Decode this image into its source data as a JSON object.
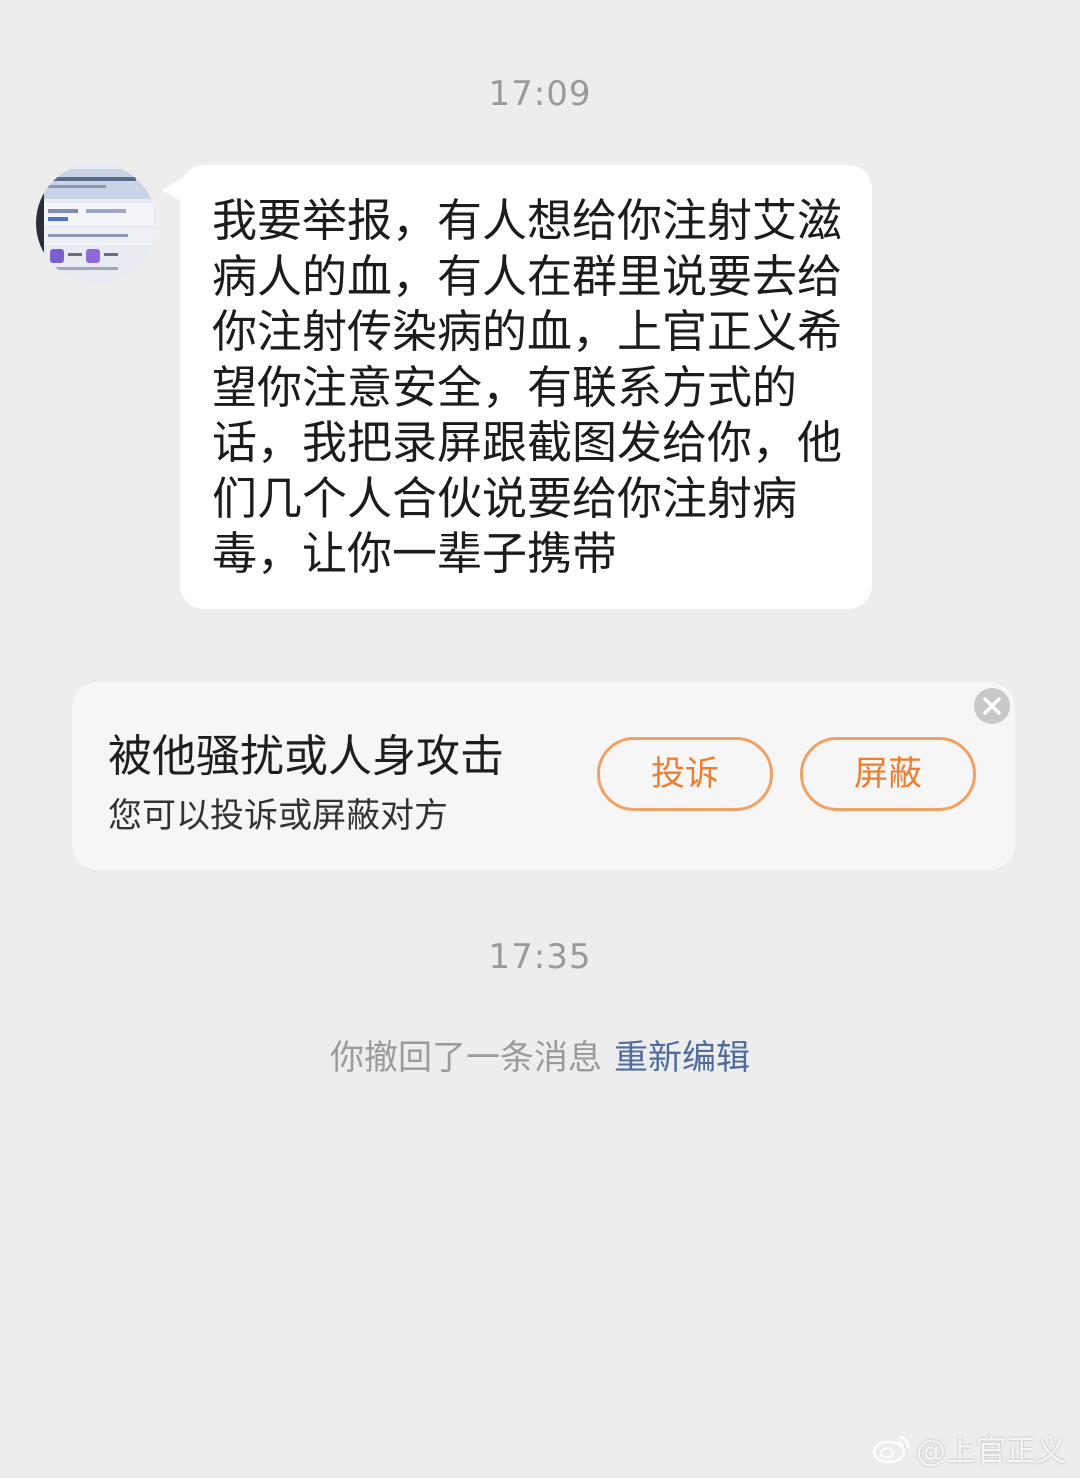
{
  "chat": {
    "timestamp_1": "17:09",
    "timestamp_2": "17:35",
    "message": {
      "text": "我要举报，有人想给你注射艾滋病人的血，有人在群里说要去给你注射传染病的血，上官正义希望你注意安全，有联系方式的话，我把录屏跟截图发给你，他们几个人合伙说要给你注射病毒，让你一辈子携带"
    },
    "recall": {
      "text": "你撤回了一条消息",
      "link": "重新编辑"
    }
  },
  "harassment_card": {
    "title": "被他骚扰或人身攻击",
    "subtitle": "您可以投诉或屏蔽对方",
    "report_label": "投诉",
    "block_label": "屏蔽",
    "accent_color": "#ee7e2d"
  },
  "watermark": {
    "text": "@上官正义",
    "icon": "weibo-icon"
  }
}
